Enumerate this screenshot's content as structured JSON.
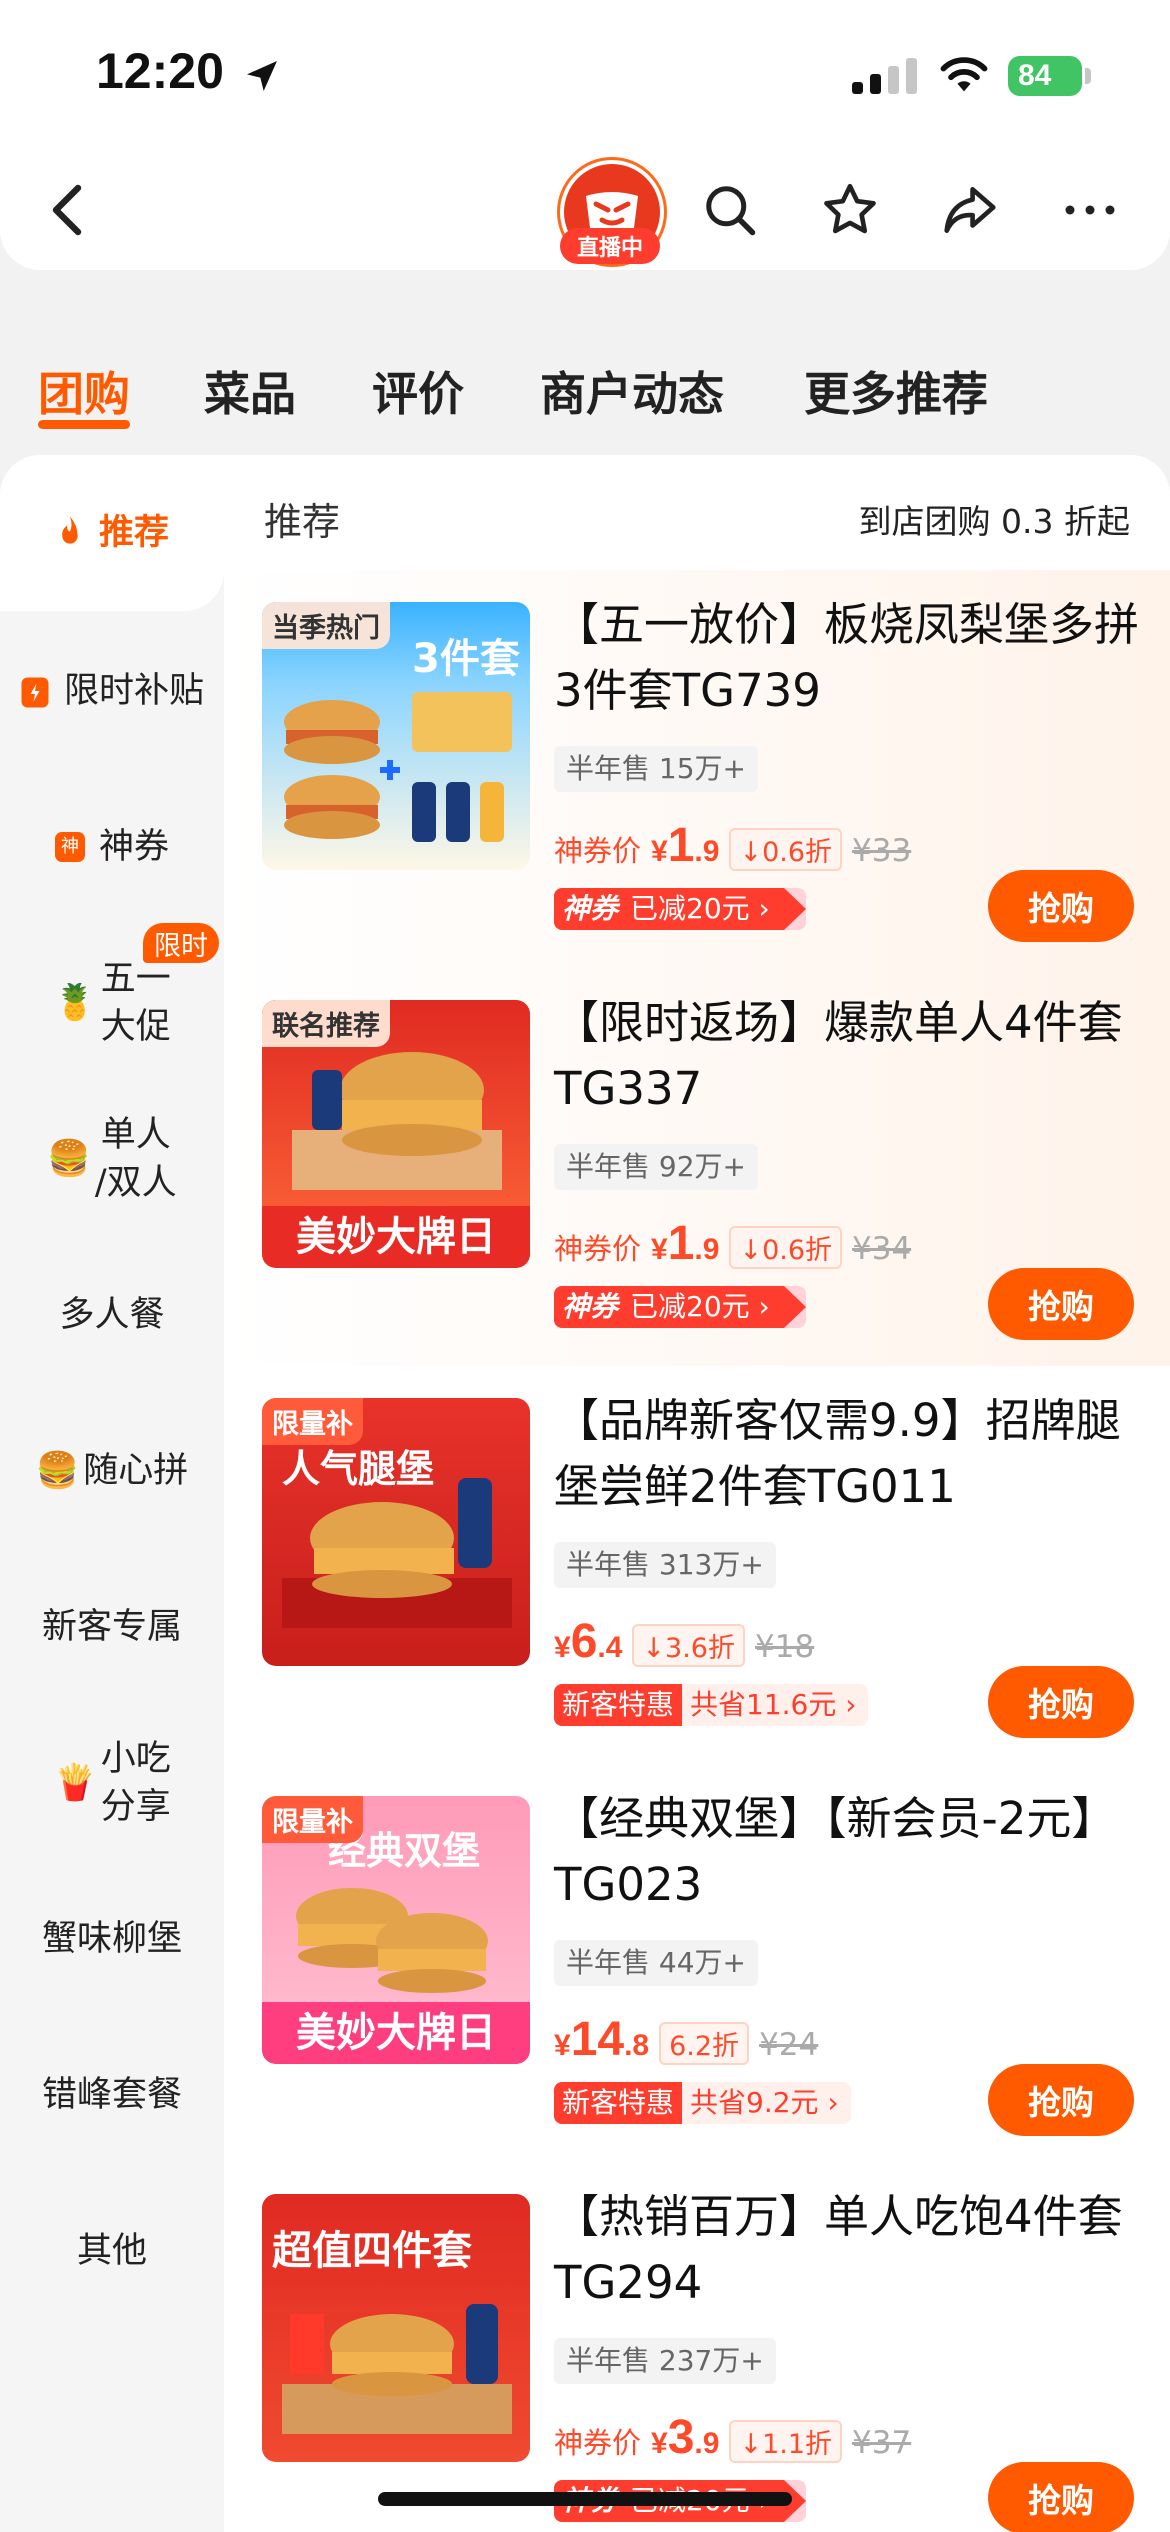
{
  "status_bar": {
    "time": "12:20",
    "battery": "84"
  },
  "nav": {
    "live_badge": "直播中"
  },
  "tabs": [
    {
      "label": "团购"
    },
    {
      "label": "菜品"
    },
    {
      "label": "评价"
    },
    {
      "label": "商户动态"
    },
    {
      "label": "更多推荐"
    }
  ],
  "sidebar": {
    "items": [
      {
        "label": "推荐"
      },
      {
        "label": "限时补贴"
      },
      {
        "label": "神券"
      },
      {
        "label": "五一\n大促",
        "emoji": "🍍"
      },
      {
        "label": "单人\n/双人",
        "emoji": "🍔"
      },
      {
        "label": "多人餐"
      },
      {
        "label": "随心拼",
        "emoji": "🍔"
      },
      {
        "label": "新客专属"
      },
      {
        "label": "小吃\n分享",
        "emoji": "🍟"
      },
      {
        "label": "蟹味柳堡"
      },
      {
        "label": "错峰套餐"
      },
      {
        "label": "其他"
      }
    ],
    "tag": "限时",
    "coupon_icon": "神"
  },
  "main": {
    "header": "推荐",
    "header_right": "到店团购 0.3 折起"
  },
  "products": [
    {
      "thumb_tag": "当季热门",
      "thumb_text": "3件套",
      "title": "【五一放价】板烧凤梨堡多拼3件套TG739",
      "sales": "半年售 15万+",
      "price_label": "神券价",
      "currency": "¥",
      "price_int": "1",
      "price_dec": ".9",
      "discount": "0.6折",
      "orig": "¥33",
      "coupon_a": "神券",
      "coupon_b": "已减20元 ›",
      "buy": "抢购"
    },
    {
      "thumb_tag": "联名推荐",
      "thumb_banner": "美妙大牌日",
      "title": "【限时返场】爆款单人4件套TG337",
      "sales": "半年售 92万+",
      "price_label": "神券价",
      "currency": "¥",
      "price_int": "1",
      "price_dec": ".9",
      "discount": "0.6折",
      "orig": "¥34",
      "coupon_a": "神券",
      "coupon_b": "已减20元 ›",
      "buy": "抢购"
    },
    {
      "thumb_tag": "限量补",
      "thumb_text": "人气腿堡",
      "title": "【品牌新客仅需9.9】招牌腿堡尝鲜2件套TG011",
      "sales": "半年售 313万+",
      "currency": "¥",
      "price_int": "6",
      "price_dec": ".4",
      "discount": "3.6折",
      "orig": "¥18",
      "new_a": "新客特惠",
      "new_b": "共省11.6元 ›",
      "buy": "抢购"
    },
    {
      "thumb_tag": "限量补",
      "thumb_text": "经典双堡",
      "thumb_banner": "美妙大牌日",
      "title": "【经典双堡】【新会员-2元】TG023",
      "sales": "半年售 44万+",
      "currency": "¥",
      "price_int": "14",
      "price_dec": ".8",
      "discount": "6.2折",
      "orig": "¥24",
      "new_a": "新客特惠",
      "new_b": "共省9.2元 ›",
      "buy": "抢购"
    },
    {
      "thumb_text": "超值四件套",
      "title": "【热销百万】单人吃饱4件套TG294",
      "sales": "半年售 237万+",
      "price_label": "神券价",
      "currency": "¥",
      "price_int": "3",
      "price_dec": ".9",
      "discount": "1.1折",
      "orig": "¥37",
      "coupon_a": "神券",
      "coupon_b": "已减20元 ›",
      "buy": "抢购"
    }
  ],
  "colors": {
    "accent": "#ff5a00",
    "price": "#ff4a2a",
    "coupon": "#ff3d2e"
  }
}
